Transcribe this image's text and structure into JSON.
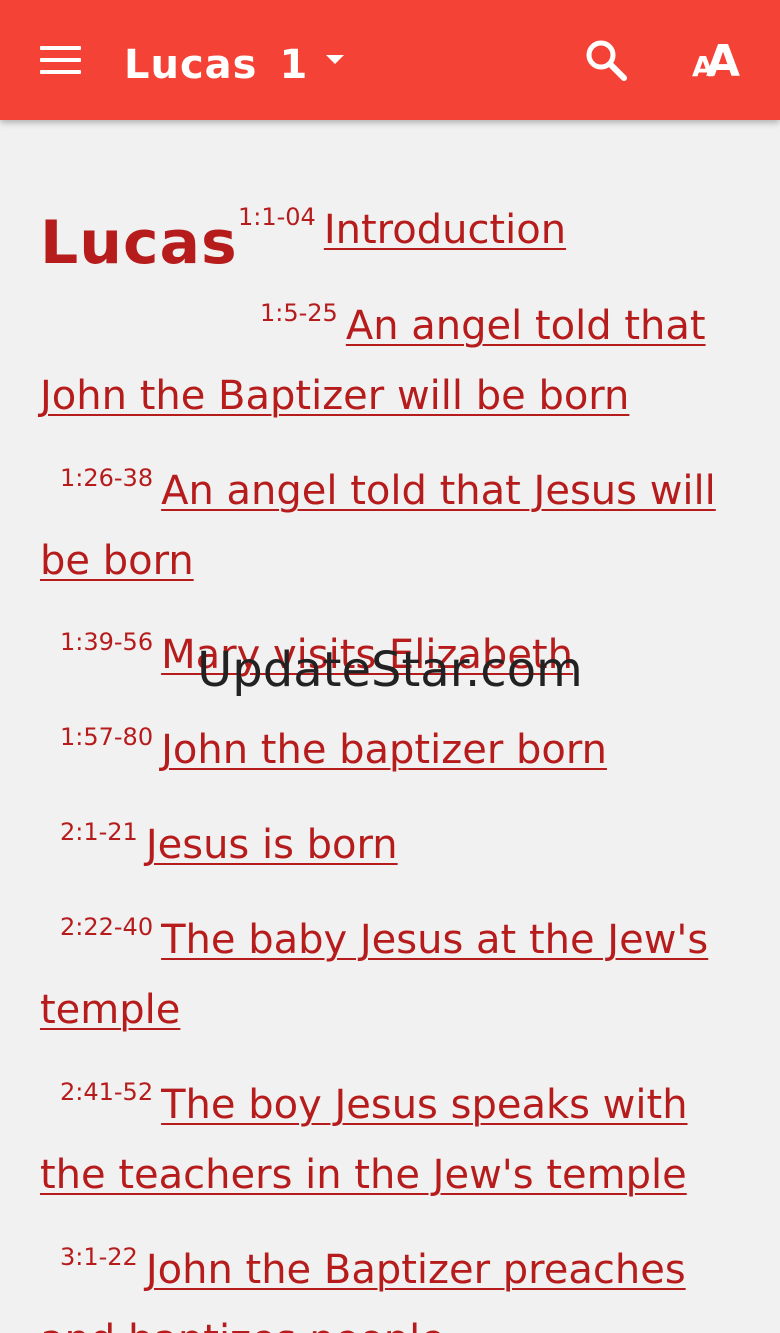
{
  "appbar": {
    "book": "Lucas",
    "chapter": "1",
    "menu_icon": "menu-icon",
    "search_icon": "search-icon",
    "font_size_icon": "font-size-icon",
    "background_color": "#f44336"
  },
  "content": {
    "book_heading": "Lucas",
    "text_color": "#b71c1c",
    "sections": [
      {
        "ref": "1:1-04",
        "title": "Introduction"
      },
      {
        "ref": "1:5-25",
        "title": "An angel told that John the Baptizer will be born"
      },
      {
        "ref": "1:26-38",
        "title": "An angel told that Jesus will be born"
      },
      {
        "ref": "1:39-56",
        "title": "Mary visits Elizabeth"
      },
      {
        "ref": "1:57-80",
        "title": "John the baptizer born"
      },
      {
        "ref": "2:1-21",
        "title": "Jesus is born"
      },
      {
        "ref": "2:22-40",
        "title": "The baby Jesus at the Jew's temple"
      },
      {
        "ref": "2:41-52",
        "title": "The boy Jesus speaks with the teachers in the Jew's temple"
      },
      {
        "ref": "3:1-22",
        "title": "John the Baptizer preaches and baptizes people"
      }
    ]
  },
  "watermark": "UpdateStar.com"
}
